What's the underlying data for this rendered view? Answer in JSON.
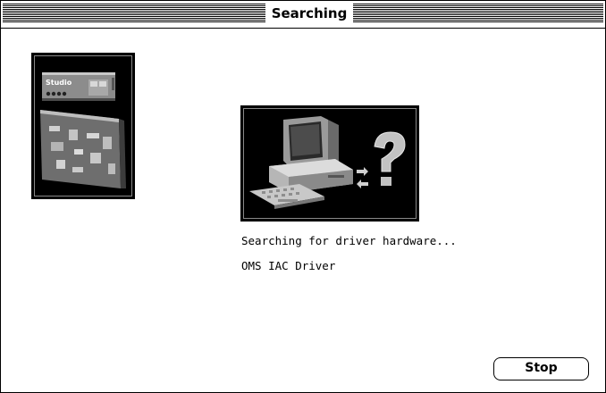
{
  "window": {
    "title": "Searching"
  },
  "studio_image": {
    "label": "Studio",
    "icon": "midi-studio-interface-icon"
  },
  "computer_image": {
    "icon": "computer-searching-icon"
  },
  "status": {
    "line1": "Searching for driver hardware...",
    "line2": "OMS IAC Driver"
  },
  "buttons": {
    "stop_label": "Stop"
  },
  "colors": {
    "background": "#ffffff",
    "foreground": "#000000"
  }
}
